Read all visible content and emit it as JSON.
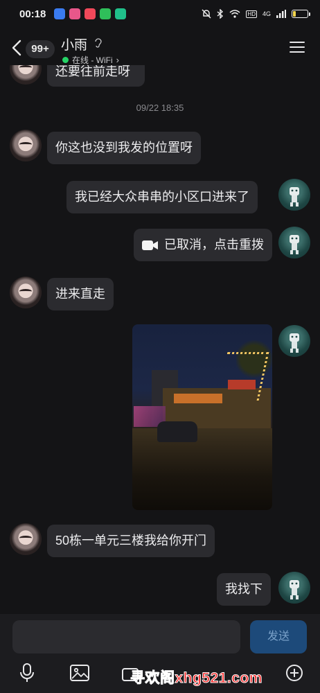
{
  "status_bar": {
    "time": "00:18",
    "network": "4G",
    "hd": "HD",
    "battery": "20",
    "battery_level": 0.2
  },
  "header": {
    "unread": "99+",
    "name": "小雨",
    "presence": "在线 - WiFi",
    "presence_color": "#25d366"
  },
  "messages": {
    "cut_text": "还要往前走呀",
    "timestamp": "09/22 18:35",
    "m1": "你这也没到我发的位置呀",
    "m2": "我已经大众串串的小区口进来了",
    "m3": "已取消，点击重拨",
    "m4": "进来直走",
    "m5": "50栋一单元三楼我给你开门",
    "m6": "我找下"
  },
  "composer": {
    "send_label": "发送"
  },
  "watermark": "寻欢阁xhg521.com",
  "colors": {
    "background": "#141416",
    "bubble": "#2b2b2f",
    "send_button": "#1d4a7a"
  }
}
